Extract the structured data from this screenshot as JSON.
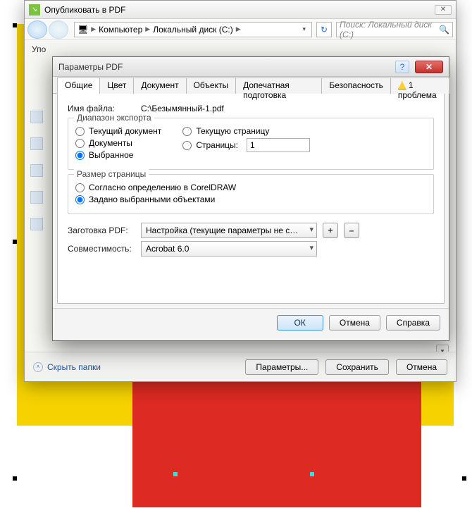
{
  "outer": {
    "title": "Опубликовать в PDF",
    "breadcrumb": {
      "computer": "Компьютер",
      "disk": "Локальный диск (C:)"
    },
    "search_placeholder": "Поиск: Локальный диск (C:)",
    "truncated": "Упо",
    "hide_folders": "Скрыть папки",
    "buttons": {
      "params": "Параметры...",
      "save": "Сохранить",
      "cancel": "Отмена"
    }
  },
  "inner": {
    "title": "Параметры PDF",
    "tabs": {
      "general": "Общие",
      "color": "Цвет",
      "document": "Документ",
      "objects": "Объекты",
      "prepress": "Допечатная подготовка",
      "security": "Безопасность",
      "problem": "1 проблема"
    },
    "filename_label": "Имя файла:",
    "filename_value": "C:\\Безымянный-1.pdf",
    "export_range": {
      "title": "Диапазон экспорта",
      "current_doc": "Текущий документ",
      "current_page": "Текущую страницу",
      "documents": "Документы",
      "pages": "Страницы:",
      "pages_value": "1",
      "selection": "Выбранное"
    },
    "page_size": {
      "title": "Размер страницы",
      "by_corel": "Согласно определению в CorelDRAW",
      "by_selection": "Задано выбранными объектами"
    },
    "preset_label": "Заготовка PDF:",
    "preset_value": "Настройка (текущие параметры не с…",
    "compat_label": "Совместимость:",
    "compat_value": "Acrobat 6.0",
    "buttons": {
      "ok": "ОК",
      "cancel": "Отмена",
      "help": "Справка"
    },
    "plus": "+",
    "minus": "–"
  }
}
